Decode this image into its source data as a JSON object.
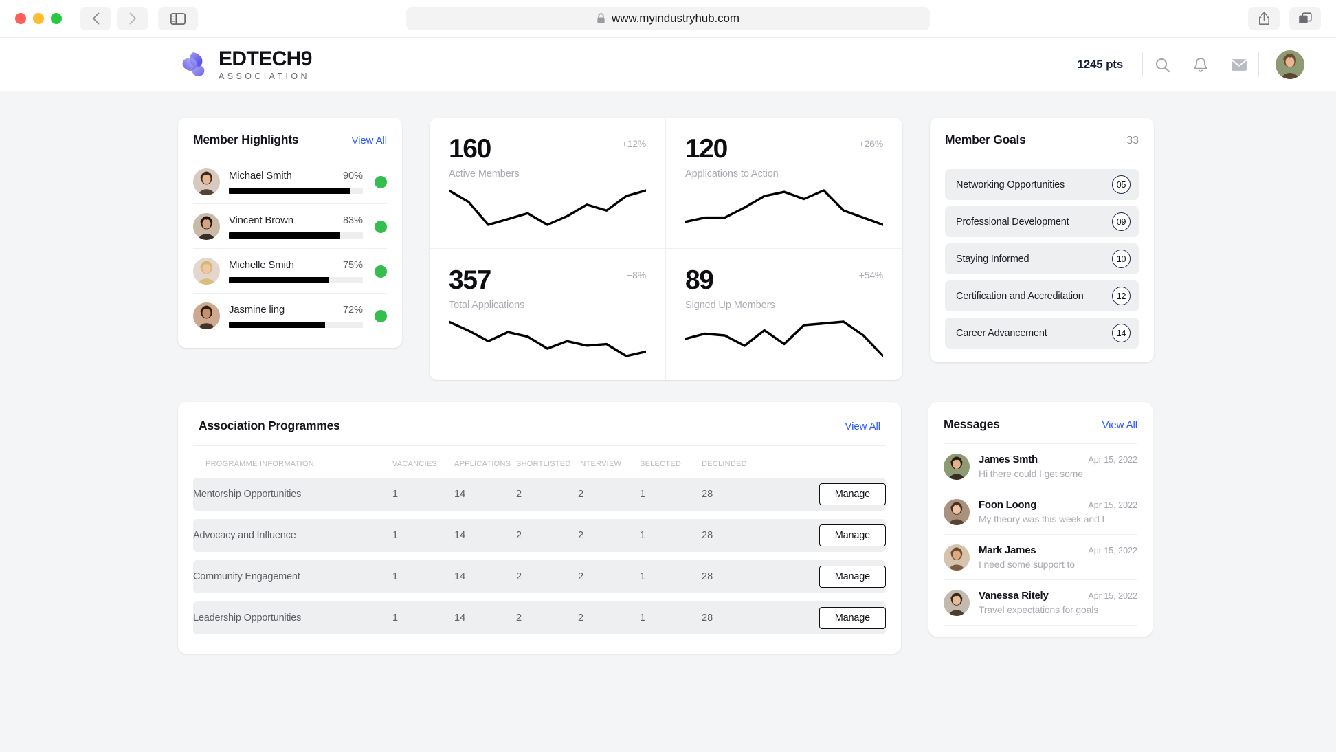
{
  "browser": {
    "url": "www.myindustryhub.com",
    "lock_icon": "lock-icon",
    "back_icon": "chevron-left-icon",
    "forward_icon": "chevron-right-icon",
    "sidebar_icon": "sidebar-toggle-icon",
    "share_icon": "share-icon",
    "tabs_icon": "tabs-overview-icon"
  },
  "header": {
    "brand_name": "EDTECH9",
    "brand_sub": "ASSOCIATION",
    "points": "1245 pts",
    "search_icon": "search-icon",
    "bell_icon": "bell-icon",
    "mail_icon": "mail-icon",
    "avatar": "user-avatar"
  },
  "highlights": {
    "title": "Member Highlights",
    "view_all": "View All",
    "members": [
      {
        "name": "Michael Smith",
        "pct": "90%",
        "value": 90,
        "status_color": "#35bd4e"
      },
      {
        "name": "Vincent Brown",
        "pct": "83%",
        "value": 83,
        "status_color": "#35bd4e"
      },
      {
        "name": "Michelle Smith",
        "pct": "75%",
        "value": 75,
        "status_color": "#35bd4e"
      },
      {
        "name": "Jasmine ling",
        "pct": "72%",
        "value": 72,
        "status_color": "#35bd4e"
      }
    ]
  },
  "stats": [
    {
      "value": "160",
      "label": "Active Members",
      "delta": "+12%",
      "trend": "up",
      "points": [
        2,
        10,
        26,
        22,
        18,
        26,
        20,
        12,
        16,
        6,
        2
      ]
    },
    {
      "value": "120",
      "label": "Applications to Action",
      "delta": "+26%",
      "trend": "up",
      "points": [
        22,
        19,
        19,
        12,
        4,
        1,
        6,
        0,
        14,
        19,
        24
      ]
    },
    {
      "value": "357",
      "label": "Total Applications",
      "delta": "−8%",
      "trend": "down",
      "points": [
        1,
        7,
        14,
        8,
        11,
        19,
        14,
        17,
        16,
        24,
        21
      ]
    },
    {
      "value": "89",
      "label": "Signed Up Members",
      "delta": "+54%",
      "trend": "up",
      "points": [
        16,
        13,
        14,
        20,
        11,
        19,
        8,
        7,
        6,
        14,
        26
      ]
    }
  ],
  "goals": {
    "title": "Member Goals",
    "count": "33",
    "items": [
      {
        "label": "Networking Opportunities",
        "badge": "05"
      },
      {
        "label": "Professional Development",
        "badge": "09"
      },
      {
        "label": "Staying Informed",
        "badge": "10"
      },
      {
        "label": "Certification and Accreditation",
        "badge": "12"
      },
      {
        "label": "Career Advancement",
        "badge": "14"
      }
    ]
  },
  "programmes": {
    "title": "Association Programmes",
    "view_all": "View All",
    "columns": [
      "PROGRAMME INFORMATION",
      "VACANCIES",
      "APPLICATIONS",
      "SHORTLISTED",
      "INTERVIEW",
      "SELECTED",
      "DECLINDED"
    ],
    "action_label": "Manage",
    "rows": [
      {
        "name": "Mentorship Opportunities",
        "vacancies": "1",
        "applications": "14",
        "shortlisted": "2",
        "interview": "2",
        "selected": "1",
        "declined": "28"
      },
      {
        "name": "Advocacy and Influence",
        "vacancies": "1",
        "applications": "14",
        "shortlisted": "2",
        "interview": "2",
        "selected": "1",
        "declined": "28"
      },
      {
        "name": "Community Engagement",
        "vacancies": "1",
        "applications": "14",
        "shortlisted": "2",
        "interview": "2",
        "selected": "1",
        "declined": "28"
      },
      {
        "name": "Leadership Opportunities",
        "vacancies": "1",
        "applications": "14",
        "shortlisted": "2",
        "interview": "2",
        "selected": "1",
        "declined": "28"
      }
    ]
  },
  "messages": {
    "title": "Messages",
    "view_all": "View All",
    "items": [
      {
        "name": "James Smth",
        "date": "Apr 15, 2022",
        "preview": "Hi there could I get some"
      },
      {
        "name": "Foon Loong",
        "date": "Apr 15, 2022",
        "preview": "My theory was this week and I"
      },
      {
        "name": "Mark James",
        "date": "Apr 15, 2022",
        "preview": "I need some support to"
      },
      {
        "name": "Vanessa Ritely",
        "date": "Apr 15, 2022",
        "preview": "Travel expectations for goals"
      }
    ]
  },
  "theme": {
    "accent_link": "#2b59ff",
    "brand_navy": "#161c3d",
    "status_green": "#35bd4e",
    "chart_stroke": "#000000",
    "page_bg": "#f4f5f7"
  },
  "chart_data": [
    {
      "type": "line",
      "title": "Active Members",
      "value": 160,
      "delta_pct": 12,
      "x": [
        0,
        1,
        2,
        3,
        4,
        5,
        6,
        7,
        8,
        9,
        10
      ],
      "values": [
        2,
        10,
        26,
        22,
        18,
        26,
        20,
        12,
        16,
        6,
        2
      ],
      "note": "values are inverted pixel heights of the sparkline (lower = higher on chart)",
      "grid": false,
      "legend": false
    },
    {
      "type": "line",
      "title": "Applications to Action",
      "value": 120,
      "delta_pct": 26,
      "x": [
        0,
        1,
        2,
        3,
        4,
        5,
        6,
        7,
        8,
        9,
        10
      ],
      "values": [
        22,
        19,
        19,
        12,
        4,
        1,
        6,
        0,
        14,
        19,
        24
      ],
      "grid": false,
      "legend": false
    },
    {
      "type": "line",
      "title": "Total Applications",
      "value": 357,
      "delta_pct": -8,
      "x": [
        0,
        1,
        2,
        3,
        4,
        5,
        6,
        7,
        8,
        9,
        10
      ],
      "values": [
        1,
        7,
        14,
        8,
        11,
        19,
        14,
        17,
        16,
        24,
        21
      ],
      "grid": false,
      "legend": false
    },
    {
      "type": "line",
      "title": "Signed Up Members",
      "value": 89,
      "delta_pct": 54,
      "x": [
        0,
        1,
        2,
        3,
        4,
        5,
        6,
        7,
        8,
        9,
        10
      ],
      "values": [
        16,
        13,
        14,
        20,
        11,
        19,
        8,
        7,
        6,
        14,
        26
      ],
      "grid": false,
      "legend": false
    }
  ]
}
